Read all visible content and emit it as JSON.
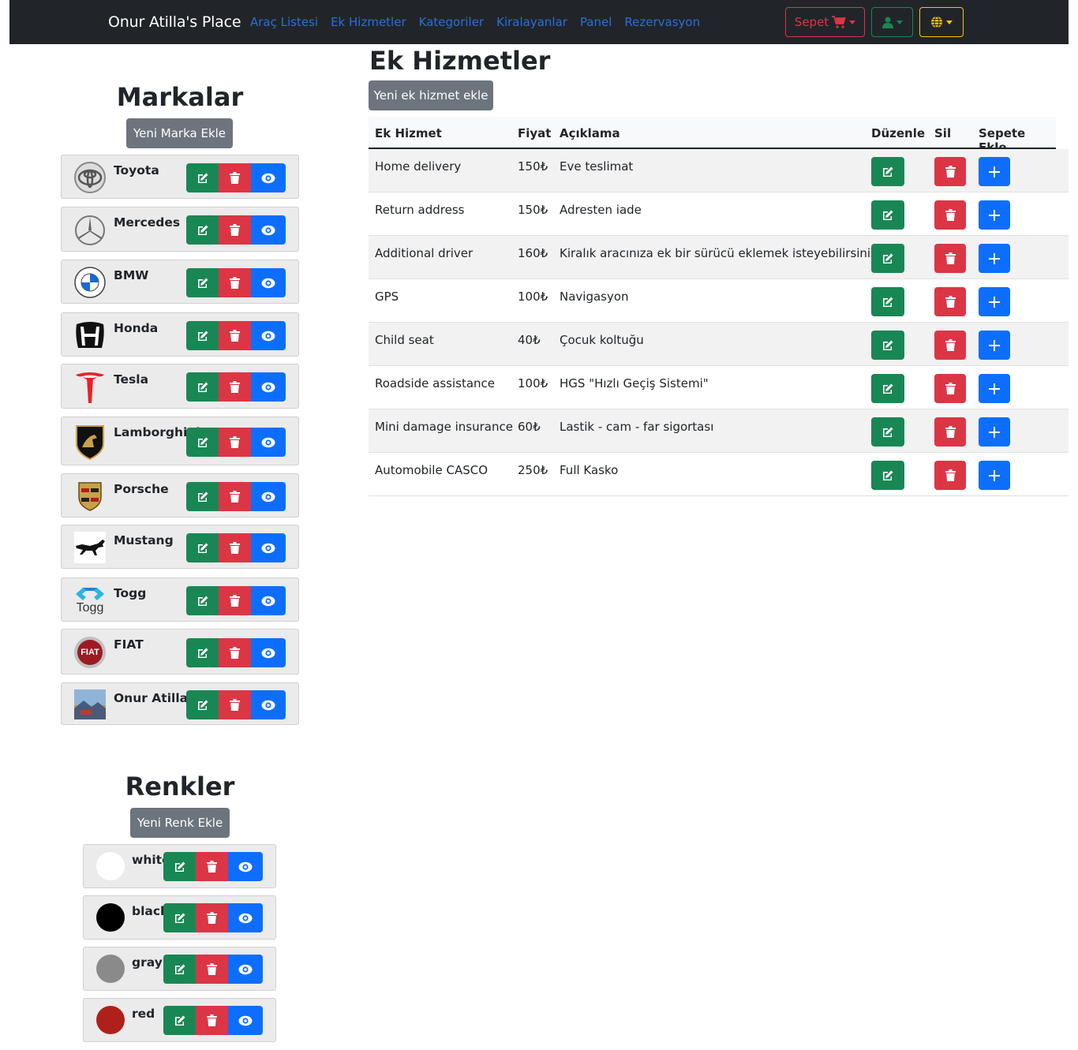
{
  "navbar": {
    "brand": "Onur Atilla's Place",
    "links": [
      "Araç Listesi",
      "Ek Hizmetler",
      "Kategoriler",
      "Kiralayanlar",
      "Panel",
      "Rezervasyon"
    ],
    "cart_label": "Sepet"
  },
  "brands": {
    "title": "Markalar",
    "add_label": "Yeni Marka Ekle",
    "items": [
      {
        "name": "Toyota",
        "logo": "toyota-logo-icon"
      },
      {
        "name": "Mercedes",
        "logo": "mercedes-logo-icon"
      },
      {
        "name": "BMW",
        "logo": "bmw-logo-icon"
      },
      {
        "name": "Honda",
        "logo": "honda-logo-icon"
      },
      {
        "name": "Tesla",
        "logo": "tesla-logo-icon"
      },
      {
        "name": "Lamborghini",
        "logo": "lamborghini-logo-icon"
      },
      {
        "name": "Porsche",
        "logo": "porsche-logo-icon"
      },
      {
        "name": "Mustang",
        "logo": "mustang-logo-icon"
      },
      {
        "name": "Togg",
        "logo": "togg-logo-icon",
        "logo_text": "Togg"
      },
      {
        "name": "FIAT",
        "logo": "fiat-logo-icon",
        "logo_text": "FIAT"
      },
      {
        "name": "Onur Atilla",
        "logo": "photo-thumbnail"
      }
    ]
  },
  "colors": {
    "title": "Renkler",
    "add_label": "Yeni Renk Ekle",
    "items": [
      {
        "name": "white",
        "hex": "#ffffff"
      },
      {
        "name": "black",
        "hex": "#000000"
      },
      {
        "name": "gray",
        "hex": "#8a8a8a"
      },
      {
        "name": "red",
        "hex": "#b0201a"
      }
    ]
  },
  "services": {
    "title": "Ek Hizmetler",
    "add_label": "Yeni ek hizmet ekle",
    "headers": {
      "name": "Ek Hizmet",
      "price": "Fiyat",
      "desc": "Açıklama",
      "edit": "Düzenle",
      "delete": "Sil",
      "cart": "Sepete Ekle"
    },
    "rows": [
      {
        "name": "Home delivery",
        "price": "150₺",
        "desc": "Eve teslimat"
      },
      {
        "name": "Return address",
        "price": "150₺",
        "desc": "Adresten iade"
      },
      {
        "name": "Additional driver",
        "price": "160₺",
        "desc": "Kiralık aracınıza ek bir sürücü eklemek isteyebilirsiniz ."
      },
      {
        "name": "GPS",
        "price": "100₺",
        "desc": "Navigasyon"
      },
      {
        "name": "Child seat",
        "price": "40₺",
        "desc": "Çocuk koltuğu"
      },
      {
        "name": "Roadside assistance",
        "price": "100₺",
        "desc": "HGS \"Hızlı Geçiş Sistemi\""
      },
      {
        "name": "Mini damage insurance",
        "price": "60₺",
        "desc": "Lastik - cam - far sigortası"
      },
      {
        "name": "Automobile CASCO",
        "price": "250₺",
        "desc": "Full Kasko"
      }
    ]
  },
  "theme": {
    "primary": "#0d6efd",
    "success": "#198754",
    "danger": "#dc3545",
    "warning": "#ffc107",
    "secondary": "#6c757d",
    "dark": "#212529"
  }
}
